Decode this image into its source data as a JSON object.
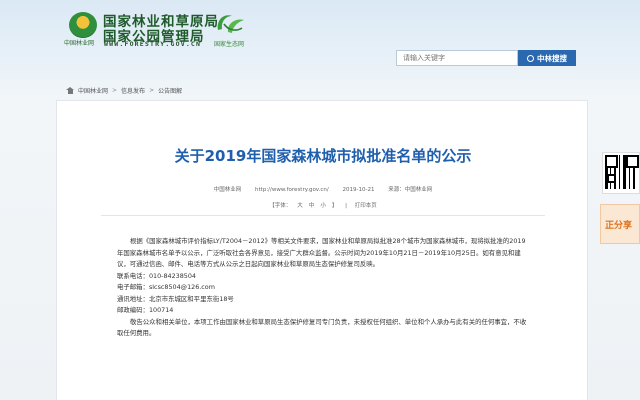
{
  "header": {
    "emblem_caption": "中国林业网",
    "title_line1": "国家林业和草原局",
    "title_line2": "国家公园管理局",
    "url": "WWW.FORESTRY.GOV.CN",
    "eco_caption": "国家生态网"
  },
  "search": {
    "placeholder": "请输入关键字",
    "button_label": "中林搜搜"
  },
  "breadcrumb": [
    "中国林业网",
    "信息发布",
    "公告图解"
  ],
  "article": {
    "title": "关于2019年国家森林城市拟批准名单的公示",
    "source": "中国林业网",
    "source_url": "http://www.forestry.gov.cn/",
    "date": "2019-10-21",
    "origin": "来源：中国林业网",
    "font_label": "【字体：",
    "font_large": "大",
    "font_medium": "中",
    "font_small": "小",
    "font_close": "】",
    "print_label": "打印本页",
    "paragraph1": "根据《国家森林城市评价指标LY/T2004－2012》等相关文件要求，国家林业和草原局拟批准28个城市为国家森林城市，现将拟批准的2019年国家森林城市名单予以公示，广泛听取社会各界意见，接受广大群众监督。公示时间为2019年10月21日－2019年10月25日。如有意见和建议，可通过信函、邮件、电话等方式从公示之日起向国家林业和草原局生态保护修复司反映。",
    "phone": "联系电话：010-84238504",
    "email": "电子邮箱：slcsc8504@126.com",
    "address": "通讯地址：北京市东城区和平里东街18号",
    "postcode": "邮政编码：100714",
    "paragraph2": "敬告公众和相关单位，本项工作由国家林业和草原局生态保护修复司专门负责，未授权任何组织、单位和个人承办与此有关的任何事宜，不收取任何费用。"
  },
  "float": {
    "button_label": "正分享"
  },
  "colors": {
    "title_blue": "#1f5fad",
    "search_button": "#2a68b0",
    "logo_green": "#1f5a2a"
  }
}
